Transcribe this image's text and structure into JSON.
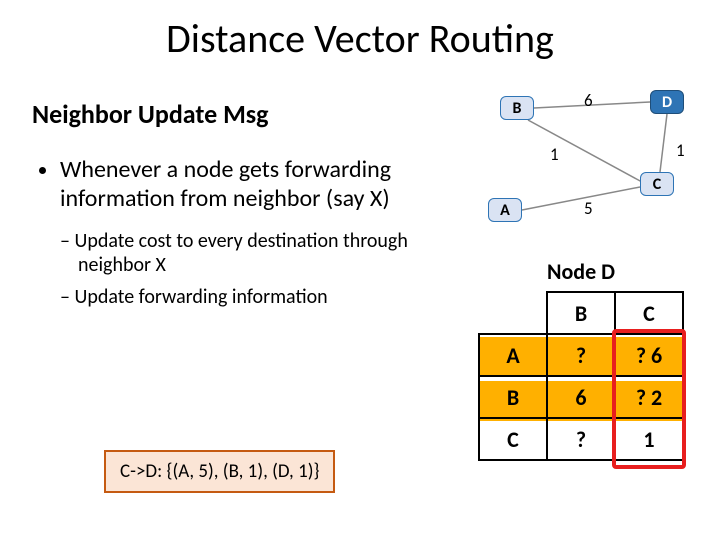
{
  "title": "Distance Vector Routing",
  "subtitle": "Neighbor Update Msg",
  "bullet": "Whenever a node gets forwarding information from neighbor (say X)",
  "sub_bullets": [
    "Update cost to every destination through neighbor X",
    "Update forwarding information"
  ],
  "msg_box": "C->D: {(A, 5), (B, 1), (D, 1)}",
  "graph": {
    "nodes": {
      "B": "B",
      "D": "D",
      "A": "A",
      "C": "C"
    },
    "edge_labels": {
      "BD": "6",
      "BC": "1",
      "CD": "1",
      "AC": "5"
    }
  },
  "table": {
    "title": "Node D",
    "col_headers": [
      "B",
      "C"
    ],
    "row_headers": [
      "A",
      "B",
      "C"
    ],
    "cells": {
      "A_B": "?",
      "A_C_old": "?",
      "A_C_new": "6",
      "B_B": "6",
      "B_C_old": "?",
      "B_C_new": "2",
      "C_B": "?",
      "C_C": "1"
    }
  }
}
